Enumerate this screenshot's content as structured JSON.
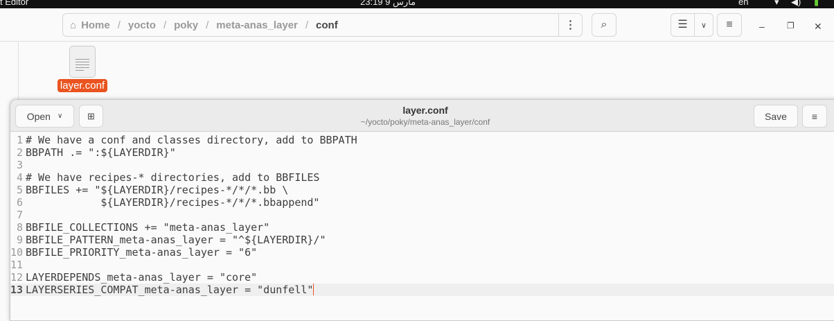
{
  "topbar": {
    "app": "t Editor",
    "clock": "23:19  9 مارس",
    "lang": "en"
  },
  "files": {
    "path": [
      {
        "label": "Home"
      },
      {
        "label": "yocto"
      },
      {
        "label": "poky"
      },
      {
        "label": "meta-anas_layer"
      },
      {
        "label": "conf"
      }
    ],
    "separator": "/",
    "items": [
      {
        "name": "layer.conf"
      }
    ]
  },
  "editor": {
    "open_label": "Open",
    "save_label": "Save",
    "title": "layer.conf",
    "subtitle": "~/yocto/poky/meta-anas_layer/conf",
    "current_line": 13,
    "lines": [
      "# We have a conf and classes directory, add to BBPATH",
      "BBPATH .= \":${LAYERDIR}\"",
      "",
      "# We have recipes-* directories, add to BBFILES",
      "BBFILES += \"${LAYERDIR}/recipes-*/*/*.bb \\",
      "            ${LAYERDIR}/recipes-*/*/*.bbappend\"",
      "",
      "BBFILE_COLLECTIONS += \"meta-anas_layer\"",
      "BBFILE_PATTERN_meta-anas_layer = \"^${LAYERDIR}/\"",
      "BBFILE_PRIORITY_meta-anas_layer = \"6\"",
      "",
      "LAYERDEPENDS_meta-anas_layer = \"core\"",
      "LAYERSERIES_COMPAT_meta-anas_layer = \"dunfell\""
    ]
  }
}
